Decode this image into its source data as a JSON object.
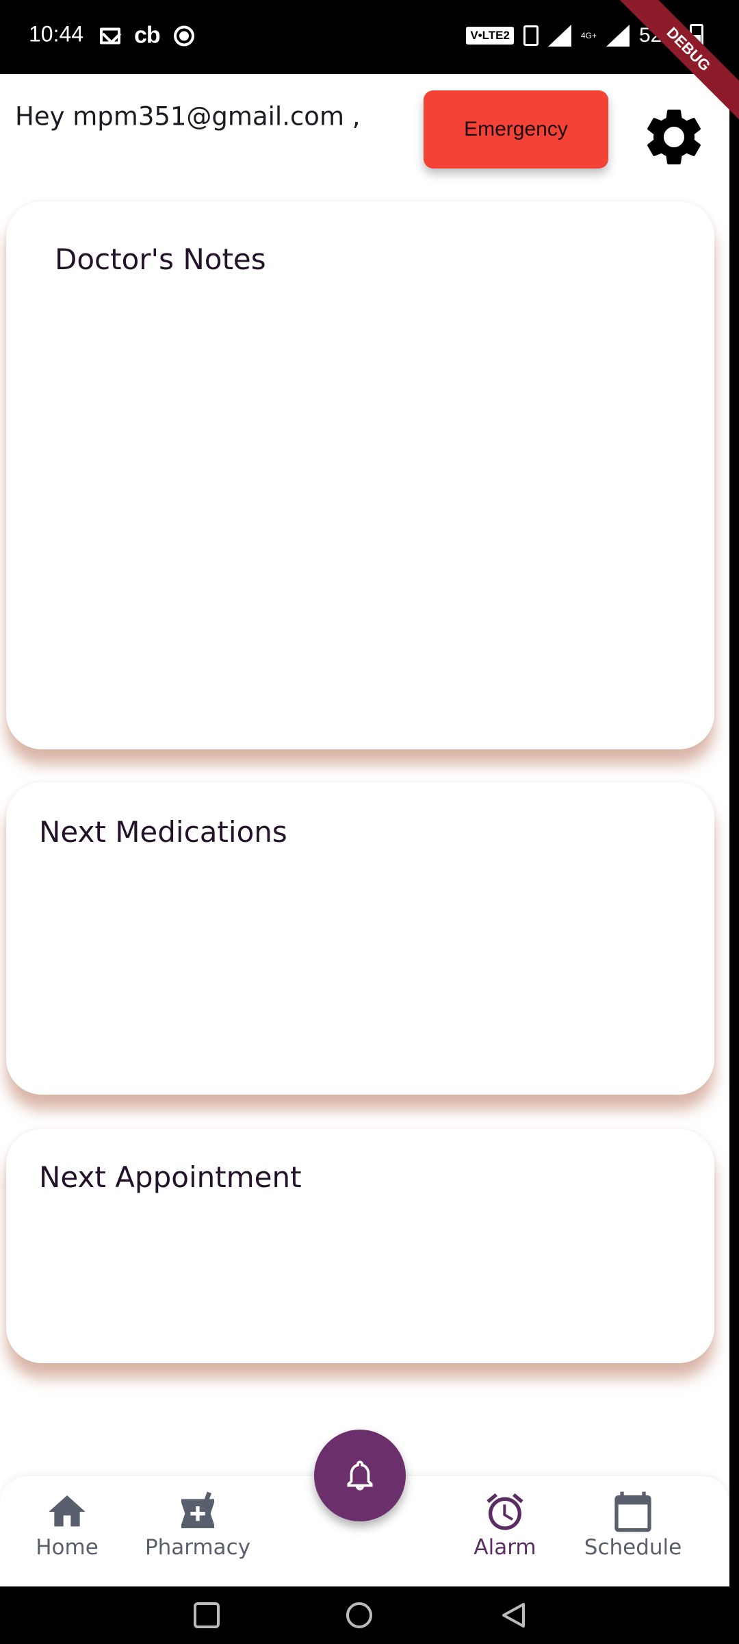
{
  "status_bar": {
    "time": "10:44",
    "carrier_icon_text": "cb",
    "volte_label": "V•LTE2",
    "network_label": "4G+",
    "battery_percent": "52%"
  },
  "debug_banner": "DEBUG",
  "header": {
    "greeting": "Hey mpm351@gmail.com ,",
    "emergency_label": "Emergency",
    "settings_icon": "gear-icon"
  },
  "cards": {
    "doctors_notes_title": "Doctor's Notes",
    "next_medications_title": "Next Medications",
    "next_appointment_title": "Next Appointment"
  },
  "bottom_nav": {
    "items": [
      {
        "label": "Home",
        "icon": "home-icon"
      },
      {
        "label": "Pharmacy",
        "icon": "pharmacy-icon"
      },
      {
        "label": "Alarm",
        "icon": "alarm-icon",
        "active": true
      },
      {
        "label": "Schedule",
        "icon": "calendar-icon"
      }
    ],
    "fab_icon": "bell-icon"
  },
  "colors": {
    "emergency": "#f44336",
    "fab": "#6b2f6b",
    "active_nav": "#5a2e62",
    "inactive_nav": "#5a5f6d"
  }
}
